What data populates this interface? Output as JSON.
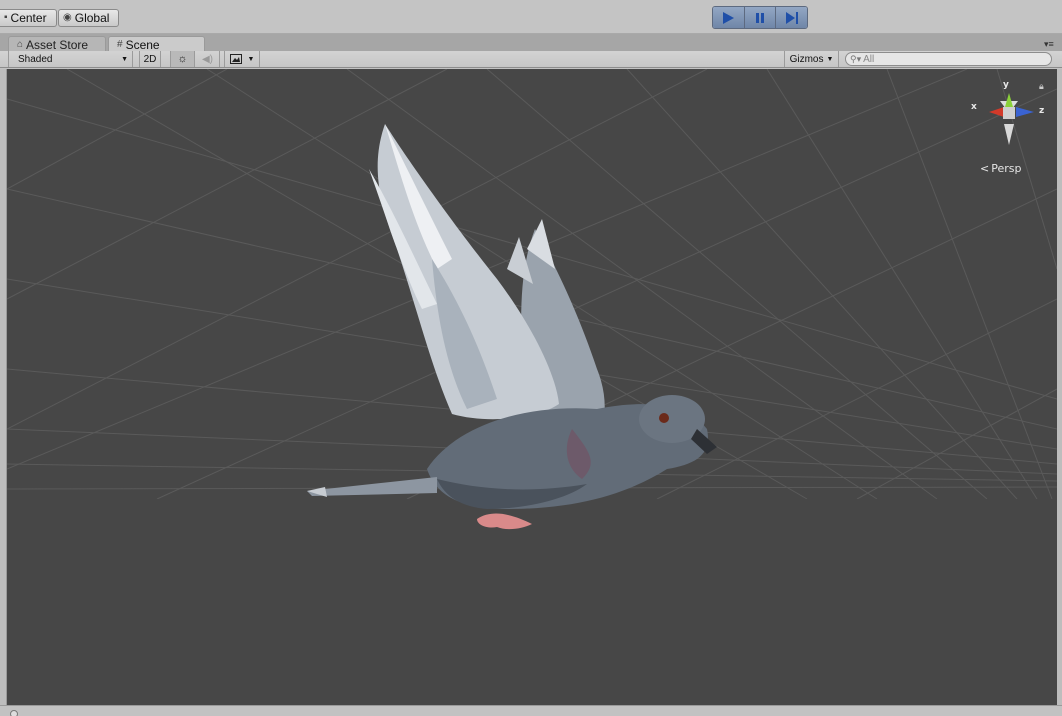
{
  "toolbar": {
    "pivot_mode": "Center",
    "pivot_rotation": "Global",
    "play_controls": [
      "play-icon",
      "pause-icon",
      "step-icon"
    ]
  },
  "tabs": [
    {
      "label": "Asset Store",
      "icon": "shopping-cart-icon",
      "active": false
    },
    {
      "label": "Scene",
      "icon": "grid-hash-icon",
      "active": true
    }
  ],
  "scene_toolbar": {
    "draw_mode": "Shaded",
    "mode_2d": "2D",
    "lighting_icon": "sun-icon",
    "audio_icon": "speaker-icon",
    "effects_icon": "image-icon",
    "gizmos_label": "Gizmos",
    "search_placeholder": "All"
  },
  "viewport": {
    "background_color": "#474747",
    "subject": "pigeon-model",
    "projection_label": "Persp",
    "axis_labels": {
      "x": "x",
      "y": "y",
      "z": "z"
    },
    "axis_colors": {
      "x": "#d23a2a",
      "y": "#8bd13a",
      "z": "#3a63d2"
    }
  }
}
